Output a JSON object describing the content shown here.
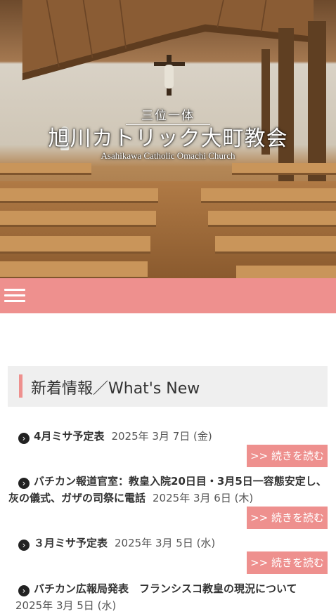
{
  "header": {
    "subtitle": "三位一体",
    "title": "旭川カトリック大町教会",
    "title_en": "Asahikawa Catholic Omachi Church"
  },
  "nav": {
    "menu_icon": "hamburger-icon"
  },
  "news": {
    "heading": "新着情報／What's New",
    "read_more_label": ">> 続きを読む",
    "items": [
      {
        "title": "4月ミサ予定表",
        "date": "2025年 3月 7日 (金)"
      },
      {
        "title": "バチカン報道官室：教皇入院20日目・3月5日一容態安定し、灰の儀式、ガザの司祭に電話",
        "date": "2025年 3月 6日 (木)"
      },
      {
        "title": "３月ミサ予定表",
        "date": "2025年 3月 5日 (水)"
      },
      {
        "title": "バチカン広報局発表　フランシスコ教皇の現況について",
        "date": "2025年 3月 5日 (水)"
      }
    ]
  }
}
